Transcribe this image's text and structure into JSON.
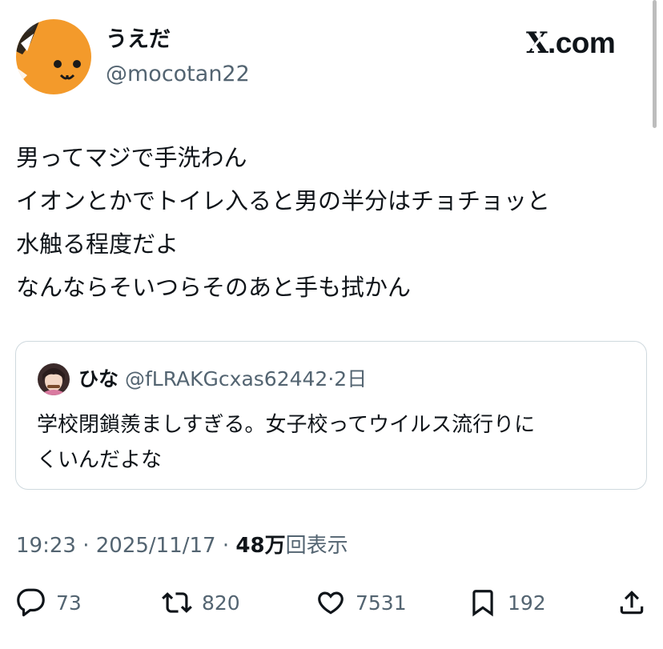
{
  "author": {
    "display_name": "うえだ",
    "handle": "@mocotan22",
    "avatar_icon": "cat-avatar-icon"
  },
  "brand": {
    "x_glyph": "X",
    "domain": ".com"
  },
  "tweet": {
    "lines": [
      "男ってマジで手洗わん",
      "イオンとかでトイレ入ると男の半分はチョチョッと",
      "水触る程度だよ",
      "なんならそいつらそのあと手も拭かん"
    ]
  },
  "quote": {
    "display_name": "ひな",
    "handle": "@fLRAKGcxas62442",
    "separator": "·",
    "time": "2日",
    "lines": [
      "学校閉鎖羨ましすぎる。女子校ってウイルス流行りに",
      "くいんだよな"
    ]
  },
  "meta": {
    "time": "19:23",
    "sep1": " · ",
    "date": "2025/11/17",
    "sep2": " · ",
    "views_count": "48万",
    "views_label": "回表示"
  },
  "actions": {
    "replies": "73",
    "reposts": "820",
    "likes": "7531",
    "bookmarks": "192"
  },
  "colors": {
    "text": "#0f1419",
    "secondary": "#536471",
    "border": "#cfd9de",
    "avatar_orange": "#f39a2b"
  }
}
